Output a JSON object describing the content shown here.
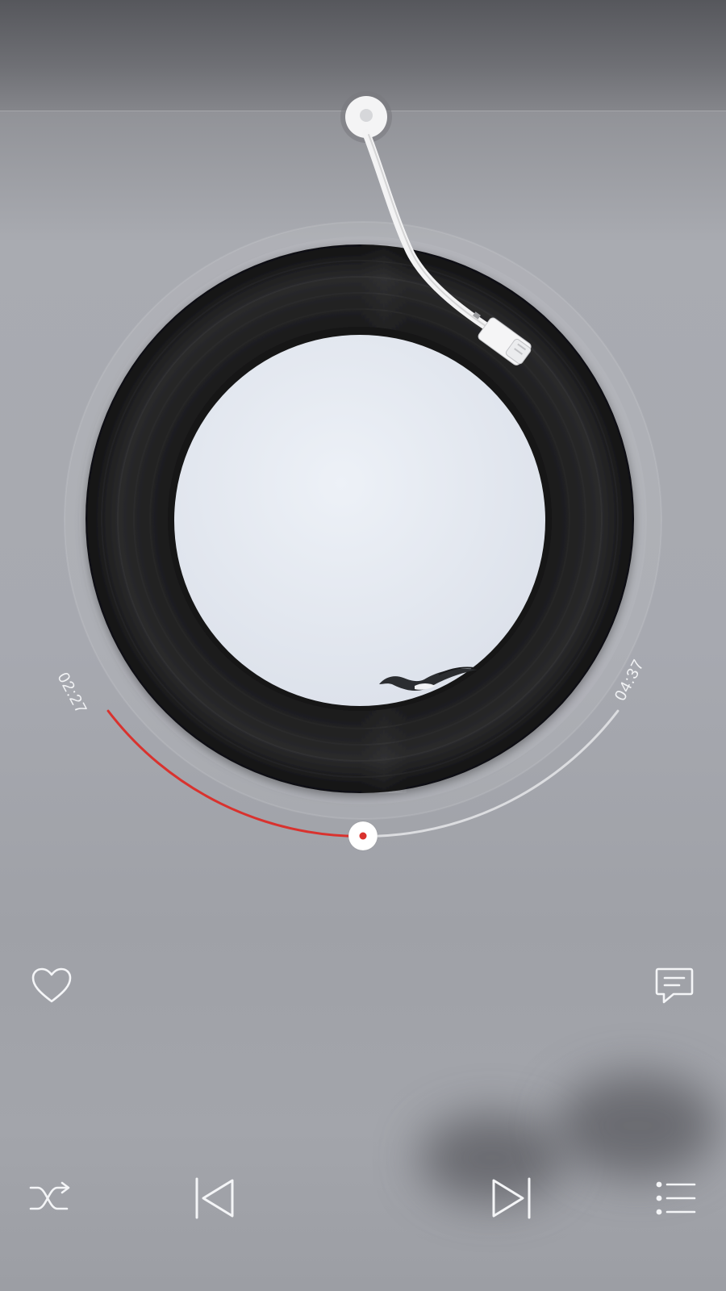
{
  "player": {
    "elapsed_time": "02:27",
    "total_time": "04:37",
    "progress_fraction": 0.531,
    "accent_color": "#d9322e"
  },
  "icons": {
    "like": "heart-icon",
    "comment": "comment-icon",
    "shuffle": "shuffle-icon",
    "previous": "previous-track-icon",
    "next": "next-track-icon",
    "playlist": "playlist-icon"
  }
}
